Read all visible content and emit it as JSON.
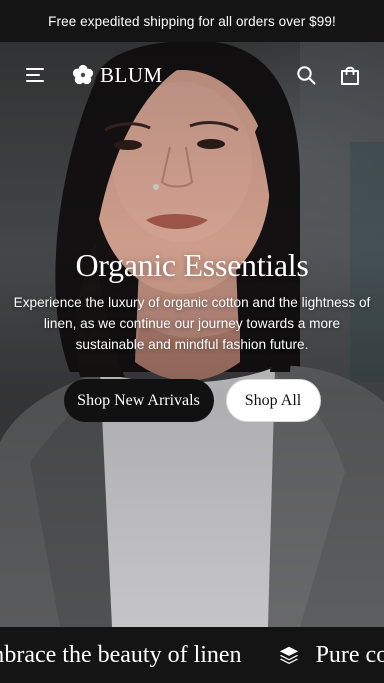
{
  "announcement": {
    "text": "Free expedited shipping for all orders over $99!"
  },
  "header": {
    "brand": "BLUM",
    "icons": [
      "menu-icon",
      "flower-logo-icon",
      "search-icon",
      "shopping-bag-icon"
    ]
  },
  "hero": {
    "title": "Organic Essentials",
    "description": "Experience the luxury of organic cotton and the lightness of linen, as we continue our journey towards a more sustainable and mindful fashion future.",
    "cta_primary": "Shop New Arrivals",
    "cta_secondary": "Shop All"
  },
  "marquee": {
    "items": [
      "Embrace the beauty of linen",
      "Pure comfort"
    ],
    "icon": "stack-layers-icon"
  },
  "colors": {
    "bar_bg": "#141414",
    "button_dark": "#111111",
    "button_light": "#ffffff",
    "text_light": "#ffffff"
  }
}
